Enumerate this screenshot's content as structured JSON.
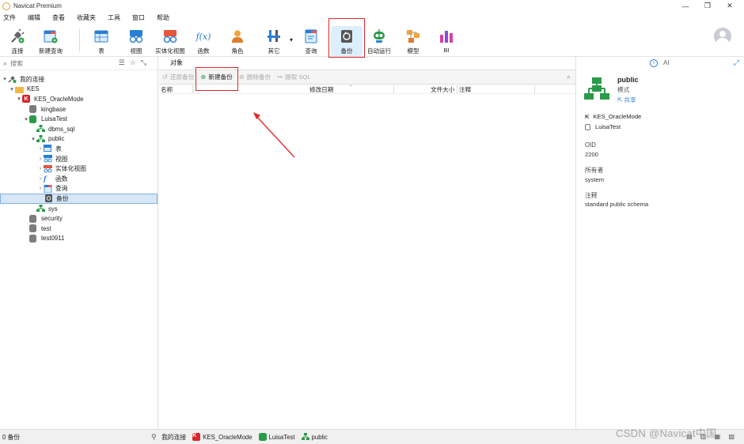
{
  "window": {
    "title": "Navicat Premium",
    "controls": [
      "—",
      "❐",
      "✕"
    ]
  },
  "menu": [
    "文件",
    "编辑",
    "查看",
    "收藏夹",
    "工具",
    "窗口",
    "帮助"
  ],
  "toolbar": {
    "connect": "连接",
    "new_query": "新建查询",
    "table": "表",
    "view": "视图",
    "mat_view": "实体化视图",
    "function": "函数",
    "role": "角色",
    "other": "其它",
    "query": "查询",
    "backup": "备份",
    "automation": "自动运行",
    "model": "模型",
    "bi": "BI",
    "function_glyph": "f(x)"
  },
  "left": {
    "search_placeholder": "搜索",
    "tree": [
      {
        "label": "我的连接",
        "level": 0,
        "caret": "▾",
        "icon": "connection"
      },
      {
        "label": "KES",
        "level": 1,
        "caret": "▾",
        "icon": "folder"
      },
      {
        "label": "KES_OracleMode",
        "level": 2,
        "caret": "▾",
        "icon": "kes"
      },
      {
        "label": "kingbase",
        "level": 3,
        "caret": "",
        "icon": "db-grey"
      },
      {
        "label": "LuisaTest",
        "level": 3,
        "caret": "▾",
        "icon": "db-green"
      },
      {
        "label": "dbms_sql",
        "level": 4,
        "caret": "",
        "icon": "schema"
      },
      {
        "label": "public",
        "level": 4,
        "caret": "▾",
        "icon": "schema"
      },
      {
        "label": "表",
        "level": 5,
        "caret": "›",
        "icon": "table"
      },
      {
        "label": "视图",
        "level": 5,
        "caret": "›",
        "icon": "view"
      },
      {
        "label": "实体化视图",
        "level": 5,
        "caret": "›",
        "icon": "matview"
      },
      {
        "label": "函数",
        "level": 5,
        "caret": "›",
        "icon": "function"
      },
      {
        "label": "查询",
        "level": 5,
        "caret": "›",
        "icon": "query"
      },
      {
        "label": "备份",
        "level": 5,
        "caret": "",
        "icon": "backup",
        "selected": true
      },
      {
        "label": "sys",
        "level": 4,
        "caret": "",
        "icon": "schema"
      },
      {
        "label": "security",
        "level": 3,
        "caret": "",
        "icon": "db-grey"
      },
      {
        "label": "test",
        "level": 3,
        "caret": "",
        "icon": "db-grey"
      },
      {
        "label": "test0911",
        "level": 3,
        "caret": "",
        "icon": "db-grey"
      }
    ]
  },
  "center": {
    "tab": "对象",
    "actions": {
      "restore": "还原备份",
      "new_backup": "新建备份",
      "delete": "删除备份",
      "extract_sql": "提取 SQL"
    },
    "columns": [
      "名称",
      "修改日期",
      "文件大小",
      "注释"
    ]
  },
  "right": {
    "ai_label": "AI",
    "object_name": "public",
    "object_type": "模式",
    "share": "共享",
    "connection": "KES_OracleMode",
    "database": "LuisaTest",
    "oid_label": "OID",
    "oid_value": "2200",
    "owner_label": "所有者",
    "owner_value": "system",
    "comment_label": "注释",
    "comment_value": "standard public schema"
  },
  "status": {
    "count": "0 备份",
    "crumbs": [
      "我的连接",
      "KES_OracleMode",
      "LuisaTest",
      "public"
    ]
  },
  "watermark": "CSDN @Navicat中国",
  "colors": {
    "highlight_red": "#e3262a",
    "selection": "#d7e7f7",
    "accent_blue": "#2a7fd4",
    "kes_red": "#d9262b",
    "db_green": "#2c9a4b"
  }
}
